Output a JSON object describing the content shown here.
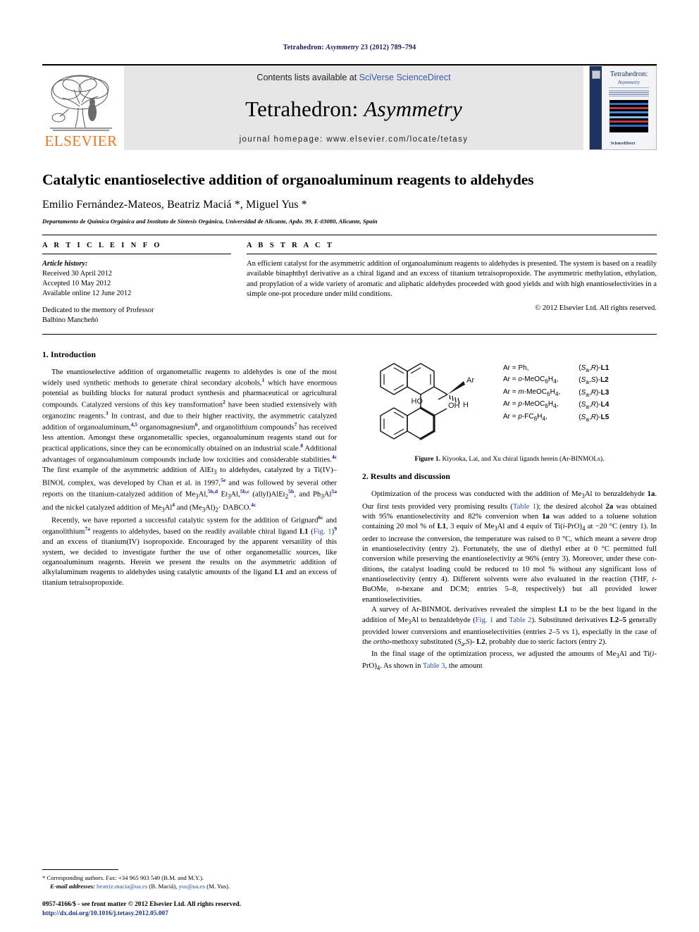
{
  "running_head": {
    "journal": "Tetrahedron:",
    "journal_italic": "Asymmetry",
    "citation": "23 (2012) 789–794"
  },
  "masthead": {
    "contents_prefix": "Contents lists available at ",
    "contents_link": "SciVerse ScienceDirect",
    "journal_title_main": "Tetrahedron: ",
    "journal_title_italic": "Asymmetry",
    "homepage": "journal homepage: www.elsevier.com/locate/tetasy",
    "publisher_wordmark": "ELSEVIER",
    "cover": {
      "title": "Tetrahedron:",
      "subtitle": "Asymmetry",
      "footer": "ScienceDirect"
    },
    "accent_orange": "#E87722",
    "link_blue": "#3a56b5"
  },
  "article": {
    "title": "Catalytic enantioselective addition of organoaluminum reagents to aldehydes",
    "authors": "Emilio Fernández-Mateos, Beatriz Maciá *, Miguel Yus *",
    "affiliation": "Departamento de Química Orgánica and Instituto de Síntesis Orgánica, Universidad de Alicante, Apdo. 99, E-03080, Alicante, Spain"
  },
  "article_info": {
    "label": "A R T I C L E   I N F O",
    "history_label": "Article history:",
    "received": "Received 30 April 2012",
    "accepted": "Accepted 10 May 2012",
    "available": "Available online 12 June 2012",
    "dedication_line1": "Dedicated to the memory of Professor",
    "dedication_line2": "Balbino Mancheñó"
  },
  "abstract": {
    "label": "A B S T R A C T",
    "text": "An efficient catalyst for the asymmetric addition of organoaluminum reagents to aldehydes is presented. The system is based on a readily available binaphthyl derivative as a chiral ligand and an excess of titanium tetraisopropoxide. The asymmetric methylation, ethylation, and propylation of a wide variety of aromatic and aliphatic aldehydes proceeded with good yields and with high enantioselectivities in a simple one-pot procedure under mild conditions.",
    "copyright": "© 2012 Elsevier Ltd. All rights reserved."
  },
  "sections": {
    "introduction_heading": "1. Introduction",
    "results_heading": "2. Results and discussion"
  },
  "intro_paragraphs": [
    "The enantioselective addition of organometallic reagents to aldehydes is one of the most widely used synthetic methods to generate chiral secondary alcohols,1 which have enormous potential as building blocks for natural product synthesis and pharmaceutical or agricultural compounds. Catalyzed versions of this key transformation2 have been studied extensively with organozinc reagents.3 In contrast, and due to their higher reactivity, the asymmetric catalyzed addition of organoaluminum,4,5 organomagnesium6, and organolithium compounds7 has received less attention. Amongst these organometallic species, organoaluminum reagents stand out for practical applications, since they can be economically obtained on an industrial scale.8 Additional advantages of organoaluminum compounds include low toxicities and considerable stabilities.4c The first example of the asymmetric addition of AlEt3 to aldehydes, catalyzed by a Ti(IV)–BINOL complex, was developed by Chan et al. in 1997,5e and was followed by several other reports on the titanium-catalyzed addition of Me3Al,5b,d Et3Al,5b,c (allyl)AlEt2,5b and Ph3Al5a and the nickel catalyzed addition of Me3Al4 and (Me3Al)2·DABCO.4c",
    "Recently, we have reported a successful catalytic system for the addition of Grignard6c and organolithium7a reagents to aldehydes, based on the readily available chiral ligand L1 (Fig. 1)9 and an excess of titanium(IV) isopropoxide. Encouraged by the apparent versatility of this system, we decided to investigate further the use of other organometallic sources, like organoaluminum reagents. Herein we present the results on the asymmetric addition of alkylaluminum reagents to aldehydes using catalytic amounts of the ligand L1 and an excess of titanium tetraisopropoxide."
  ],
  "figure": {
    "ar_labels": [
      "Ar = Ph,",
      "Ar = o-MeOC6H4,",
      "Ar = m-MeOC6H4,",
      "Ar = p-MeOC6H4,",
      "Ar = p-FC6H4,"
    ],
    "ligand_labels": [
      "(Sa,R)-L1",
      "(Sa,S)-L2",
      "(Sa,R)-L3",
      "(Sa,R)-L4",
      "(Sa,R)-L5"
    ],
    "structure_atoms": {
      "ar": "Ar",
      "h": "H",
      "ho": "HO",
      "oh": "OH"
    },
    "caption_label": "Figure 1.",
    "caption_text": "Kiyooka, Lai, and Xu chiral ligands herein (Ar-BINMOLs)."
  },
  "results_paragraphs": [
    "Optimization of the process was conducted with the addition of Me3Al to benzaldehyde 1a. Our first tests provided very promising results (Table 1); the desired alcohol 2a was obtained with 95% enantioselectivity and 82% conversion when 1a was added to a toluene solution containing 20 mol % of L1, 3 equiv of Me3Al and 4 equiv of Ti(i-PrO)4 at −20 °C (entry 1). In order to increase the conversion, the temperature was raised to 0 °C, which meant a severe drop in enantioselectivity (entry 2). Fortunately, the use of diethyl ether at 0 °C permitted full conversion while preserving the enantioselectivity at 96% (entry 3). Moreover, under these conditions, the catalyst loading could be reduced to 10 mol % without any significant loss of enantioselectivity (entry 4). Different solvents were also evaluated in the reaction (THF, t-BuOMe, n-hexane and DCM; entries 5–8, respectively) but all provided lower enantioselectivities.",
    "A survey of Ar-BINMOL derivatives revealed the simplest L1 to be the best ligand in the addition of Me3Al to benzaldehyde (Fig. 1 and Table 2). Substituted derivatives L2–5 generally provided lower conversions and enantioselectivities (entries 2–5 vs 1), especially in the case of the ortho-methoxy substituted (Sa,S)-L2, probably due to steric factors (entry 2).",
    "In the final stage of the optimization process, we adjusted the amounts of Me3Al and Ti(i-PrO)4. As shown in Table 3, the amount"
  ],
  "footnotes": {
    "corresponding": "* Corresponding authors. Fax: +34 965 903 549 (B.M. and M.Y.).",
    "email_label": "E-mail addresses:",
    "email_1": "beatriz.macia@ua.es",
    "email_1_who": "(B. Maciá),",
    "email_2": "yus@ua.es",
    "email_2_who": "(M. Yus).",
    "issn_line": "0957-4166/$ - see front matter © 2012 Elsevier Ltd. All rights reserved.",
    "doi": "http://dx.doi.org/10.1016/j.tetasy.2012.05.007"
  }
}
